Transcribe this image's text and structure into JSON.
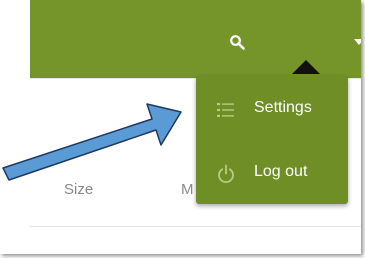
{
  "header": {
    "background": "#75942a",
    "icons": [
      "search-icon",
      "chevron-down-icon"
    ]
  },
  "table": {
    "columns": [
      "Size",
      "M"
    ]
  },
  "user_menu": {
    "background": "#6f8e25",
    "items": [
      {
        "label": "Settings",
        "icon": "list-icon"
      },
      {
        "label": "Log out",
        "icon": "power-icon"
      }
    ]
  },
  "annotation": {
    "arrow_color": "#5b9bd5",
    "arrow_outline": "#1f3864"
  }
}
